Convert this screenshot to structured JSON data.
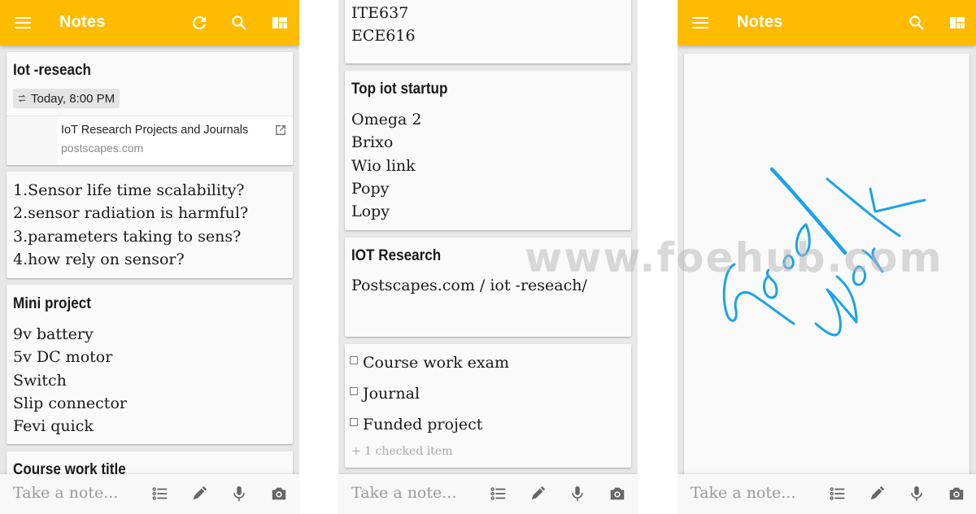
{
  "app": {
    "title": "Notes",
    "accent_color": "#ffbb00",
    "ink_color": "#1aa3e8"
  },
  "panel1": {
    "toolbar_icons": [
      "menu-icon",
      "refresh-icon",
      "search-icon",
      "layout-icon"
    ],
    "notes": [
      {
        "title": "Iot -reseach",
        "reminder": "Today, 8:00 PM",
        "link": {
          "title": "IoT Research Projects and Journals",
          "domain": "postscapes.com"
        }
      },
      {
        "lines": [
          "1.Sensor life time scalability?",
          "2.sensor radiation is harmful?",
          "3.parameters taking to sens?",
          "4.how rely on sensor?"
        ]
      },
      {
        "title": "Mini project",
        "lines": [
          "9v battery",
          "5v DC motor",
          "Switch",
          "Slip connector",
          "Fevi quick"
        ]
      },
      {
        "title": "Course work title"
      }
    ]
  },
  "panel2": {
    "notes": [
      {
        "lines": [
          "ITE637",
          "ECE616"
        ]
      },
      {
        "title": "Top iot startup",
        "lines": [
          "Omega 2",
          "Brixo",
          "Wio link",
          "Popy",
          "Lopy"
        ]
      },
      {
        "title": "IOT Research",
        "lines": [
          "Postscapes.com / iot -reseach/"
        ]
      },
      {
        "checklist": [
          "Course work exam",
          "Journal",
          "Funded project"
        ],
        "checked_count_label": "+ 1 checked item"
      }
    ]
  },
  "panel3": {
    "toolbar_icons": [
      "menu-icon",
      "search-icon",
      "layout-icon"
    ],
    "drawing_text": "Good Work"
  },
  "bottombar": {
    "placeholder": "Take a note...",
    "icons": [
      "checklist-icon",
      "pen-icon",
      "mic-icon",
      "camera-icon"
    ]
  },
  "watermark": "www.foehub.com"
}
